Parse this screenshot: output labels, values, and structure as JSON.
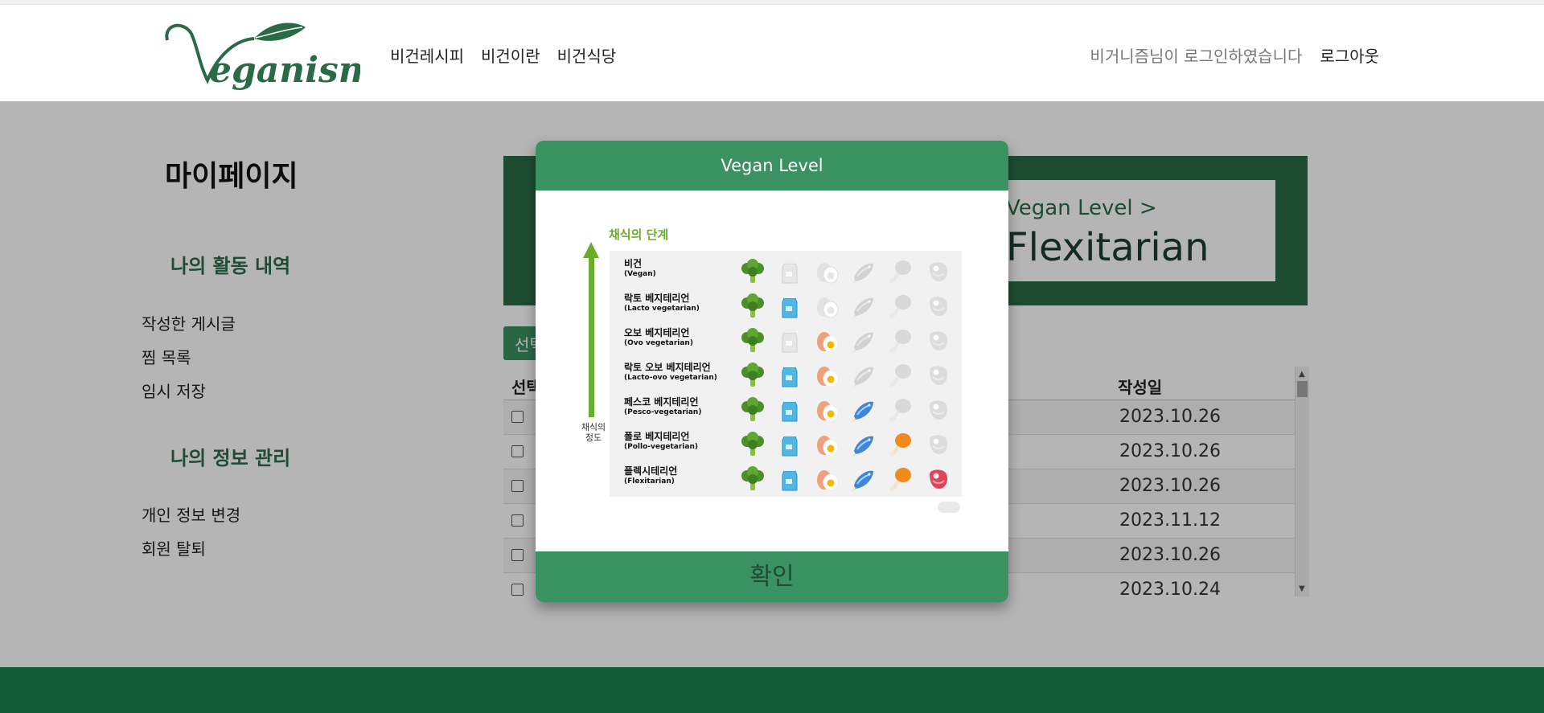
{
  "header": {
    "logo_text": "Veganism",
    "nav": [
      "비건레시피",
      "비건이란",
      "비건식당"
    ],
    "login_status": "비거니즘님이 로그인하였습니다",
    "logout": "로그아웃"
  },
  "sidebar": {
    "title": "마이페이지",
    "activity_title": "나의 활동 내역",
    "activity_items": [
      "작성한 게시글",
      "찜 목록",
      "임시 저장"
    ],
    "info_title": "나의 정보 관리",
    "info_items": [
      "개인 정보 변경",
      "회원 탈퇴"
    ]
  },
  "level_box": {
    "label": "Vegan Level >",
    "value": "Flexitarian"
  },
  "table": {
    "select_button": "선택",
    "col_select": "선택",
    "col_date": "작성일",
    "rows": [
      "2023.10.26",
      "2023.10.26",
      "2023.10.26",
      "2023.11.12",
      "2023.10.26",
      "2023.10.24"
    ]
  },
  "modal": {
    "title": "Vegan Level",
    "confirm": "확인",
    "infographic": {
      "title": "채식의 단계",
      "axis_label": "채식의 정도",
      "levels": [
        {
          "ko": "비건",
          "en": "(Vegan)",
          "allowed": [
            1,
            0,
            0,
            0,
            0,
            0
          ]
        },
        {
          "ko": "락토 베지테리언",
          "en": "(Lacto vegetarian)",
          "allowed": [
            1,
            1,
            0,
            0,
            0,
            0
          ]
        },
        {
          "ko": "오보 베지테리언",
          "en": "(Ovo vegetarian)",
          "allowed": [
            1,
            0,
            1,
            0,
            0,
            0
          ]
        },
        {
          "ko": "락토 오보 베지테리언",
          "en": "(Lacto-ovo vegetarian)",
          "allowed": [
            1,
            1,
            1,
            0,
            0,
            0
          ]
        },
        {
          "ko": "페스코 베지테리언",
          "en": "(Pesco-vegetarian)",
          "allowed": [
            1,
            1,
            1,
            1,
            0,
            0
          ]
        },
        {
          "ko": "폴로 베지테리언",
          "en": "(Pollo-vegetarian)",
          "allowed": [
            1,
            1,
            1,
            1,
            1,
            0
          ]
        },
        {
          "ko": "플렉시테리언",
          "en": "(Flexitarian)",
          "allowed": [
            1,
            1,
            1,
            1,
            1,
            1
          ]
        }
      ],
      "food_icons": [
        "broccoli-icon",
        "milk-icon",
        "egg-icon",
        "fish-icon",
        "chicken-icon",
        "meat-icon"
      ]
    }
  },
  "colors": {
    "brand_green": "#2a6b46",
    "button_green": "#3a9161",
    "footer_green": "#125c37",
    "infographic_green": "#6aac2b"
  }
}
